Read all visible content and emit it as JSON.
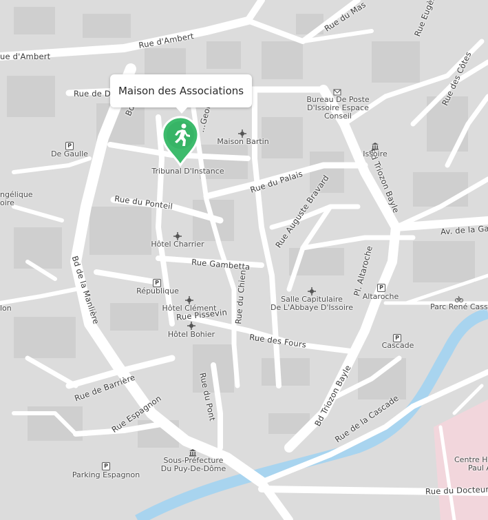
{
  "popup": {
    "title": "Maison des Associations"
  },
  "marker": {
    "icon": "running-person-icon",
    "color": "#3dbb6c"
  },
  "streets": {
    "rue_d_ambert_w": "ue d'Ambert",
    "rue_d_ambert": "Rue d'Ambert",
    "rue_du_mas": "Rue du Mas",
    "rue_eugene_gauttier": "Rue Eugène Gauttier",
    "rue_des_cotes": "Rue des Côtes",
    "rue_de_di": "Rue de Di",
    "bd_isson": "Bd ...isson",
    "rue_george": "...George",
    "rue_du_palais": "Rue du Palais",
    "rue_du_ponteil": "Rue du Ponteil",
    "rue_auguste_bravard": "Rue Auguste Bravard",
    "bd_triozon_bayle_n": "Bd Triozon Bayle",
    "av_de_la_ga": "Av. de la Ga",
    "bd_de_la_manliere": "Bd de la Manlière",
    "rue_gambetta": "Rue Gambetta",
    "pl_altaroche": "Pl. Altaroche",
    "rue_du_chien": "Rue du Chien",
    "rue_pissevin": "Rue Pissevin",
    "rue_des_fours": "Rue des Fours",
    "rue_de_barriere": "Rue de Barrière",
    "rue_du_pont": "Rue du Pont",
    "bd_triozon_bayle_s": "Bd Triozon Bayle",
    "rue_de_la_cascade": "Rue de la Cascade",
    "rue_espagnon": "Rue Espagnon",
    "rue_du_docteur": "Rue du Docteur"
  },
  "pois": {
    "bureau_de_poste": [
      "Bureau De Poste",
      "D'Issoire Espace",
      "Conseil"
    ],
    "maison_bartin": "Maison Bartin",
    "de_gaulle": "De Gaulle",
    "issoire": "Issoire",
    "tribunal": "Tribunal D'Instance",
    "angelique": [
      "ngélique",
      "oire"
    ],
    "hotel_charrier": "Hôtel Charrier",
    "republique": "République",
    "altaroche": "Altaroche",
    "salle_capitulaire": [
      "Salle Capitulaire",
      "De L'Abbaye D'Issoire"
    ],
    "lon": "lon",
    "parc_rene_cassin": "Parc René Cassin",
    "hotel_clement": "Hôtel Clément",
    "hotel_bohier": "Hôtel Bohier",
    "cascade": "Cascade",
    "sous_prefecture": [
      "Sous-Préfecture",
      "Du Puy-De-Dôme"
    ],
    "parking_espagnon": "Parking Espagnon",
    "centre_hospitalier": [
      "Centre Ho",
      "Paul A"
    ]
  },
  "icons": {
    "parking": "P",
    "post": "post-office-icon",
    "bank": "bank-icon",
    "monument": "monument-icon",
    "bike": "bicycle-icon"
  },
  "colors": {
    "background": "#dcdcdc",
    "road": "#ffffff",
    "building": "#cfcfcf",
    "water": "#a8d4ef",
    "hospital": "#f2d6dc",
    "marker": "#3dbb6c"
  }
}
